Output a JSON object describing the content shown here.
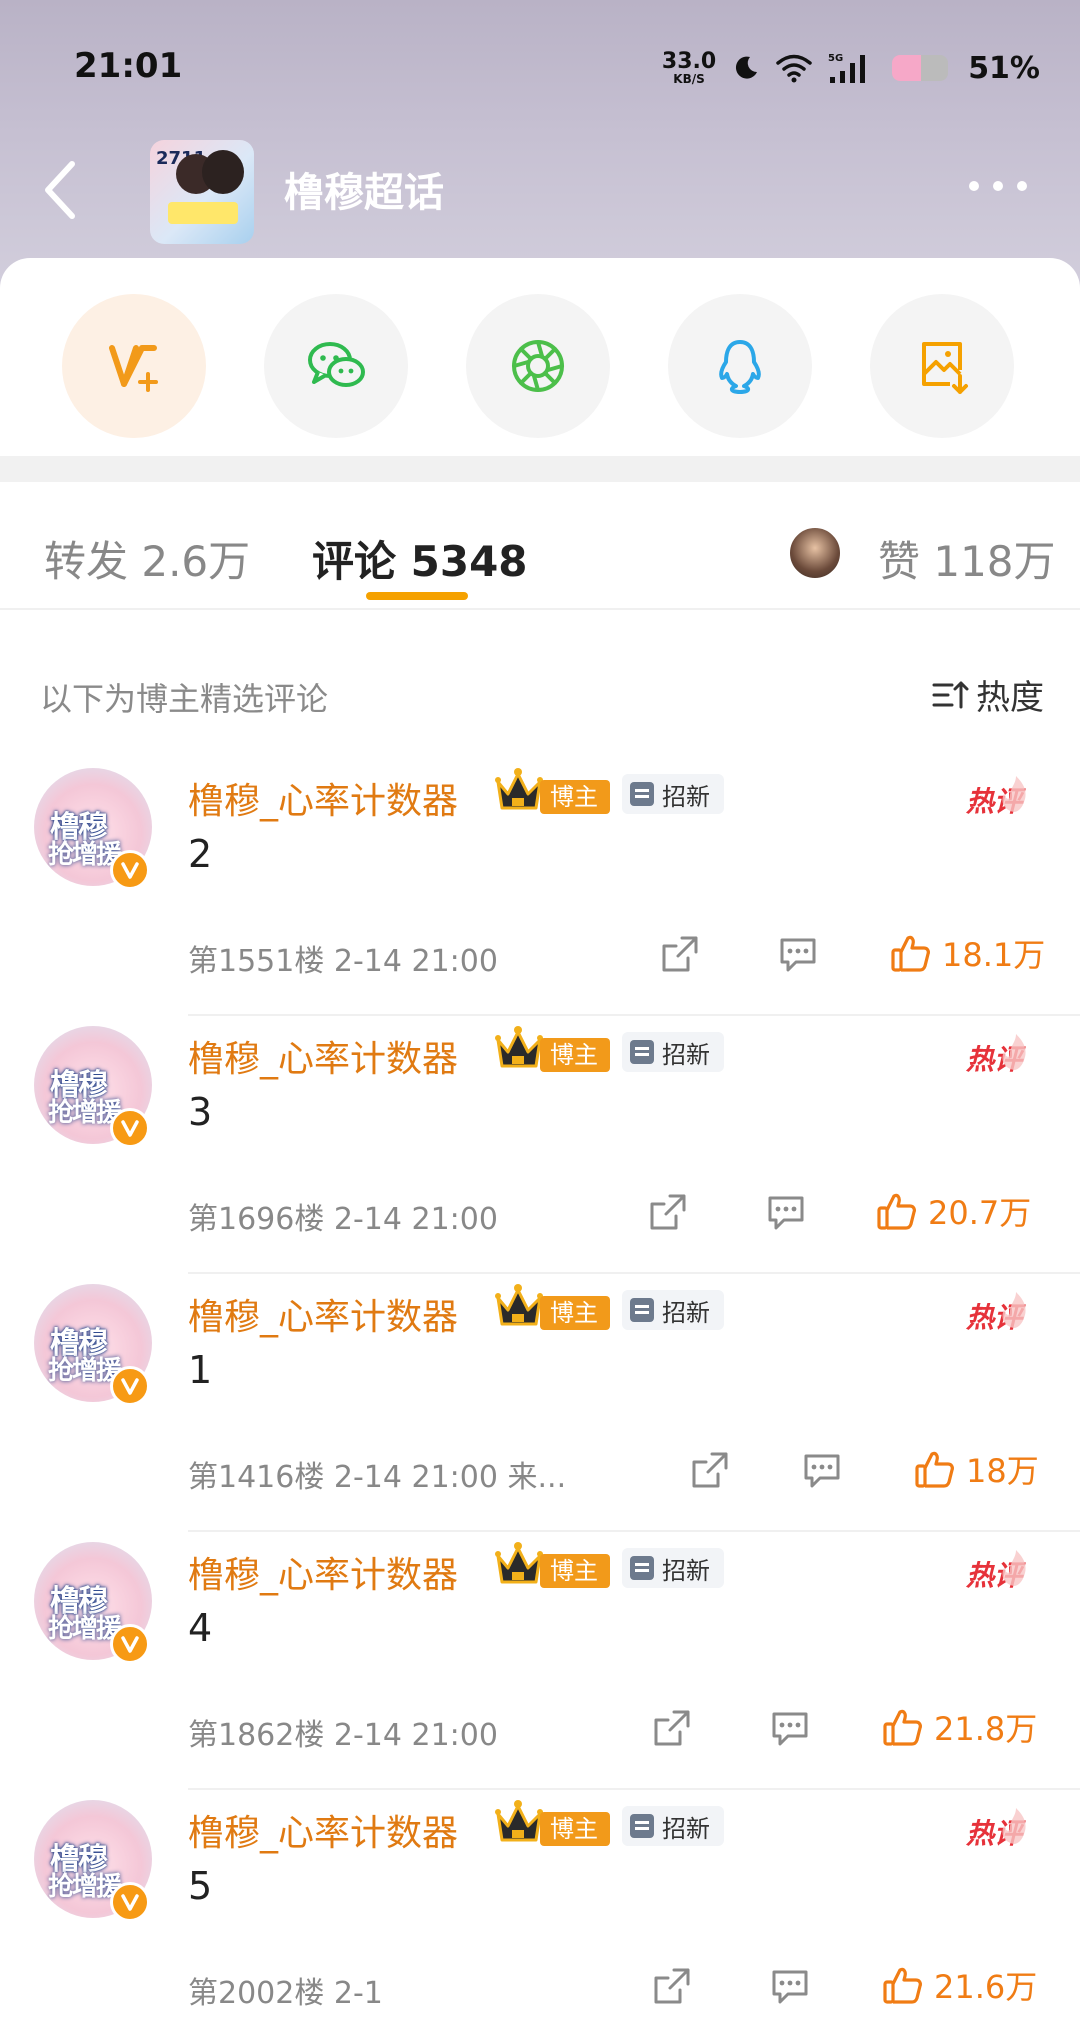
{
  "status_bar": {
    "time": "21:01",
    "net_speed_value": "33.0",
    "net_speed_unit": "KB/S",
    "network_type": "5G",
    "battery_percent": "51%",
    "battery_level": 0.51
  },
  "nav": {
    "title": "橹穆超话",
    "avatar_badge": "2711"
  },
  "share": {
    "items": [
      "v-plus-icon",
      "wechat-icon",
      "moments-icon",
      "qq-icon",
      "save-image-icon"
    ],
    "colors": {
      "vplus": "#f29a1a",
      "wechat": "#2fba4f",
      "moments": "#4cbf4a",
      "qq": "#2ba7e8",
      "save": "#f5a100"
    }
  },
  "tabs": {
    "repost": "转发 2.6万",
    "comments": "评论 5348",
    "likes": "赞 118万"
  },
  "filter": {
    "label": "以下为博主精选评论",
    "sort_label": "热度"
  },
  "comments": [
    {
      "author": "橹穆_心率计数器",
      "role": "博主",
      "badge": "招新",
      "hot": "热评",
      "text": "2",
      "meta": "第1551楼  2-14 21:00",
      "likes": "18.1万"
    },
    {
      "author": "橹穆_心率计数器",
      "role": "博主",
      "badge": "招新",
      "hot": "热评",
      "text": "3",
      "meta": "第1696楼  2-14 21:00",
      "likes": "20.7万"
    },
    {
      "author": "橹穆_心率计数器",
      "role": "博主",
      "badge": "招新",
      "hot": "热评",
      "text": "1",
      "meta": "第1416楼  2-14 21:00  来...",
      "likes": "18万"
    },
    {
      "author": "橹穆_心率计数器",
      "role": "博主",
      "badge": "招新",
      "hot": "热评",
      "text": "4",
      "meta": "第1862楼  2-14 21:00",
      "likes": "21.8万"
    },
    {
      "author": "橹穆_心率计数器",
      "role": "博主",
      "badge": "招新",
      "hot": "热评",
      "text": "5",
      "meta": "第2002楼  2-1",
      "likes": "21.6万"
    }
  ],
  "comment_avatar_text": {
    "line1": "橹穆",
    "line2": "抢增援"
  }
}
